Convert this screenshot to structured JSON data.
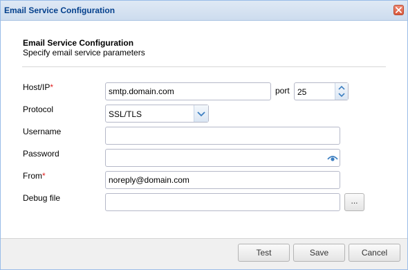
{
  "window": {
    "title": "Email Service Configuration"
  },
  "header": {
    "title": "Email Service Configuration",
    "description": "Specify email service parameters"
  },
  "form": {
    "host": {
      "label": "Host/IP",
      "required_mark": "*",
      "value": "smtp.domain.com"
    },
    "port": {
      "label": "port",
      "value": "25"
    },
    "protocol": {
      "label": "Protocol",
      "value": "SSL/TLS"
    },
    "username": {
      "label": "Username",
      "value": ""
    },
    "password": {
      "label": "Password",
      "value": ""
    },
    "from": {
      "label": "From",
      "required_mark": "*",
      "value": "noreply@domain.com"
    },
    "debug_file": {
      "label": "Debug file",
      "value": "",
      "browse_label": "..."
    }
  },
  "footer": {
    "test_label": "Test",
    "save_label": "Save",
    "cancel_label": "Cancel"
  },
  "colors": {
    "title_text": "#04408c",
    "required": "#e02020",
    "icon_blue": "#3d7fc1"
  },
  "icons": [
    "close-icon",
    "chevron-down-icon",
    "spinner-up-icon",
    "spinner-down-icon",
    "eye-icon"
  ]
}
